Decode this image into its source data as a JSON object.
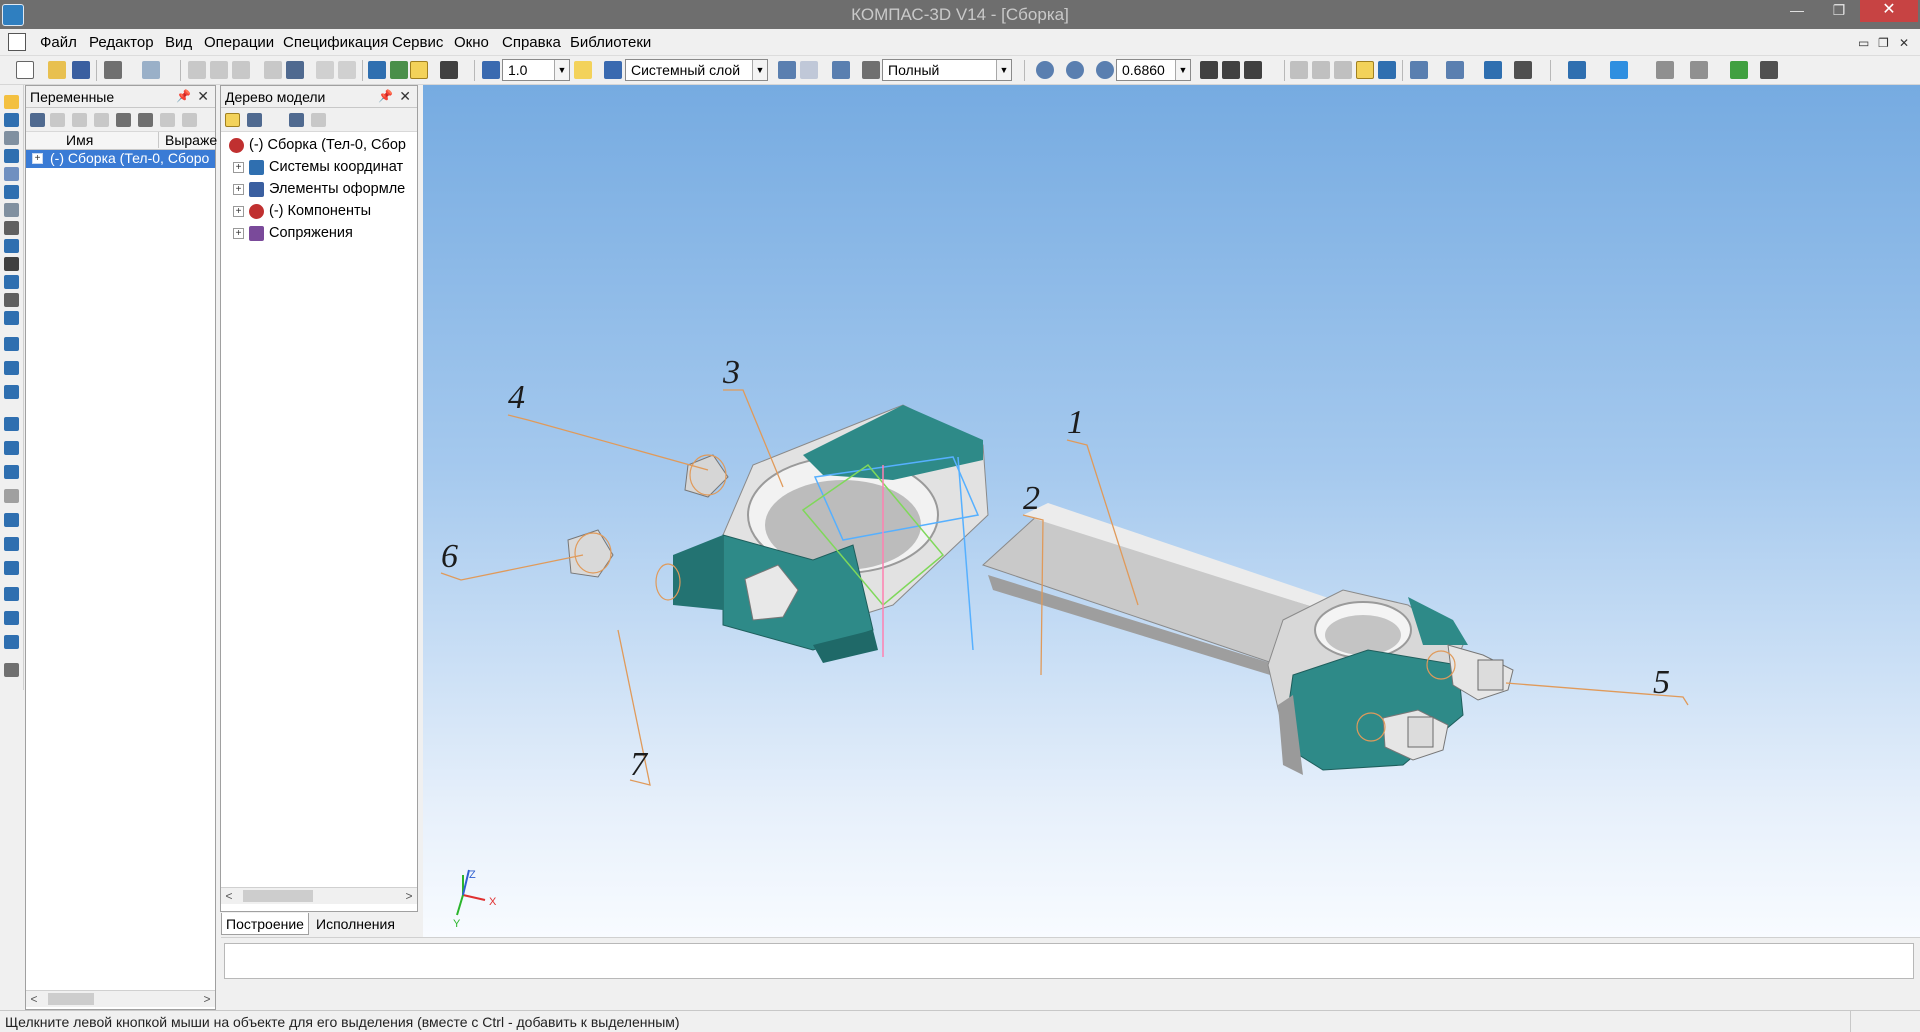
{
  "window": {
    "title": "КОМПАС-3D V14 - [Сборка]",
    "minimize": "—",
    "maximize": "❐",
    "close": "✕"
  },
  "menu": {
    "items": [
      "Файл",
      "Редактор",
      "Вид",
      "Операции",
      "Спецификация",
      "Сервис",
      "Окно",
      "Справка",
      "Библиотеки"
    ],
    "mdi_controls": [
      "▭",
      "❐",
      "✕"
    ]
  },
  "toolbar": {
    "step_value": "1.0",
    "layer_value": "Системный слой",
    "display_mode": "Полный",
    "zoom_value": "0.6860",
    "combo_arrow": "▼"
  },
  "variables_panel": {
    "title": "Переменные",
    "pin": "📌",
    "close": "✕",
    "col_name": "Имя",
    "col_expr": "Выраже",
    "row_label": "(-) Сборка (Тел-0, Сборо",
    "expander": "+"
  },
  "tree_panel": {
    "title": "Дерево модели",
    "pin": "📌",
    "close": "✕",
    "root": "(-) Сборка (Тел-0, Сбор",
    "items": [
      {
        "label": "Системы координат"
      },
      {
        "label": "Элементы оформле"
      },
      {
        "label": "(-) Компоненты"
      },
      {
        "label": "Сопряжения"
      }
    ],
    "expander": "+"
  },
  "tabs": {
    "build": "Построение",
    "versions": "Исполнения"
  },
  "scroll": {
    "left": "<",
    "right": ">"
  },
  "viewport": {
    "callouts": [
      "1",
      "2",
      "3",
      "4",
      "5",
      "6",
      "7"
    ],
    "axis_x": "X",
    "axis_y": "Y",
    "axis_z": "Z"
  },
  "status": {
    "text": "Щелкните левой кнопкой мыши на объекте для его выделения (вместе с Ctrl - добавить к выделенным)"
  },
  "colors": {
    "part_teal": "#2e8a88",
    "part_silver": "#d2d2d2",
    "callout_line": "#e09a5a",
    "selection": "#3a7bd5"
  }
}
